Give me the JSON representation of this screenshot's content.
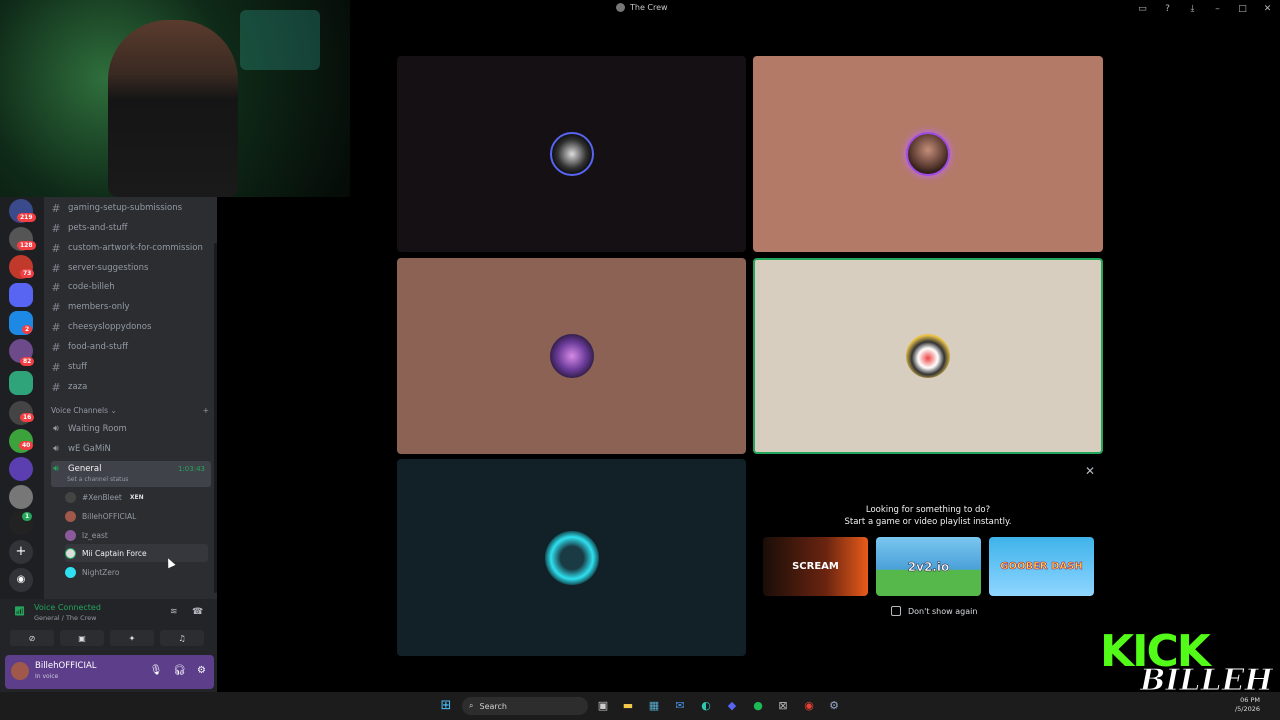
{
  "window": {
    "title": "The Crew"
  },
  "titlebar_icons": [
    "inbox-icon",
    "help-icon",
    "download-icon",
    "minimize-icon",
    "maximize-icon",
    "close-icon"
  ],
  "servers": [
    {
      "badge": "219"
    },
    {
      "badge": "128"
    },
    {
      "badge": "73"
    },
    {
      "badge": ""
    },
    {
      "badge": "2"
    },
    {
      "badge": "82"
    },
    {
      "badge": ""
    },
    {
      "badge": "16"
    },
    {
      "badge": "40"
    },
    {
      "badge": ""
    },
    {
      "badge": ""
    },
    {
      "badge": "1"
    }
  ],
  "text_channels": [
    "gaming-setup-submissions",
    "pets-and-stuff",
    "custom-artwork-for-commission",
    "server-suggestions",
    "code-billeh",
    "members-only",
    "cheesysloppydonos",
    "food-and-stuff",
    "stuff",
    "zaza"
  ],
  "voice_section": {
    "label": "Voice Channels",
    "add": "+"
  },
  "voice_channels": [
    {
      "name": "Waiting Room"
    },
    {
      "name": "wE GaMiN"
    }
  ],
  "active_voice": {
    "name": "General",
    "timer": "1:03:43",
    "status": "Set a channel status"
  },
  "members": [
    {
      "name": "#XenBleet",
      "tag": "XEN"
    },
    {
      "name": "BillehOFFICIAL",
      "tag": ""
    },
    {
      "name": "lz_east",
      "tag": ""
    },
    {
      "name": "Mii Captain Force",
      "tag": ""
    },
    {
      "name": "NightZero",
      "tag": ""
    }
  ],
  "voice_panel": {
    "status": "Voice Connected",
    "location": "General / The Crew"
  },
  "user": {
    "name": "BillehOFFICIAL",
    "status": "In voice"
  },
  "promo": {
    "line1": "Looking for something to do?",
    "line2": "Start a game or video playlist instantly.",
    "games": [
      "SCREAM",
      "2v2.io",
      "GOOBER DASH"
    ],
    "dont_show": "Don't show again"
  },
  "overlay": {
    "kick": "KICK",
    "streamer": "BILLEH"
  },
  "taskbar": {
    "search": "Search",
    "time": "06 PM",
    "date": "/5/2026"
  },
  "colors": {
    "tile1": "#141013",
    "tile2": "#b47a68",
    "tile3": "#8c6255",
    "tile4": "#d7cebf",
    "tile5": "#122127",
    "speaking_border": "#23a55a",
    "user_panel": "#5c3e8a",
    "kick_green": "#53fc18"
  }
}
